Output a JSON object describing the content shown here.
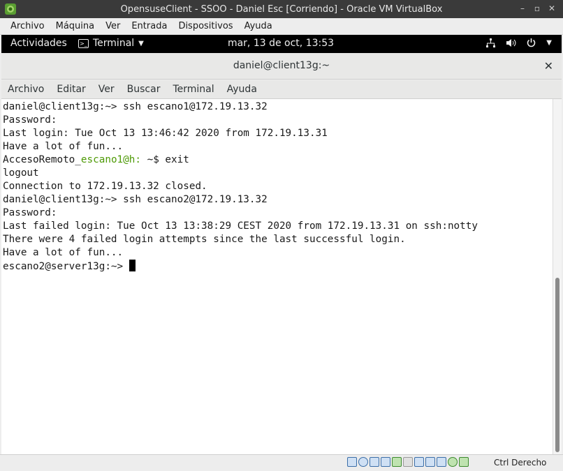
{
  "vbox": {
    "title": "OpensuseClient - SSOO - Daniel Esc [Corriendo] - Oracle VM VirtualBox",
    "menu": [
      "Archivo",
      "Máquina",
      "Ver",
      "Entrada",
      "Dispositivos",
      "Ayuda"
    ],
    "host_key": "Ctrl Derecho",
    "status_icons": [
      "hard-disk-icon",
      "optical-drive-icon",
      "audio-icon",
      "network-icon",
      "usb-icon",
      "shared-folders-icon",
      "display-icon",
      "video-capture-icon",
      "virtualization-icon",
      "mouse-integration-icon",
      "keyboard-capture-icon"
    ]
  },
  "gnome": {
    "activities": "Actividades",
    "app_menu": "Terminal",
    "clock": "mar, 13 de oct, 13:53",
    "tray_icons": [
      "network-wired-icon",
      "volume-icon",
      "power-icon"
    ]
  },
  "terminal": {
    "title": "daniel@client13g:~",
    "menu": [
      "Archivo",
      "Editar",
      "Ver",
      "Buscar",
      "Terminal",
      "Ayuda"
    ],
    "lines": [
      "daniel@client13g:~> ssh escano1@172.19.13.32",
      "Password:",
      "Last login: Tue Oct 13 13:46:42 2020 from 172.19.13.31",
      "Have a lot of fun...",
      "AccesoRemoto_",
      "logout",
      "Connection to 172.19.13.32 closed.",
      "daniel@client13g:~> ssh escano2@172.19.13.32",
      "Password:",
      "Last failed login: Tue Oct 13 13:38:29 CEST 2020 from 172.19.13.31 on ssh:notty",
      "There were 4 failed login attempts since the last successful login.",
      "Have a lot of fun...",
      "escano2@server13g:~> "
    ],
    "prompt_line": {
      "prefix": "AccesoRemoto_",
      "user_host": "escano1@h:",
      "command": " ~$ exit"
    }
  }
}
